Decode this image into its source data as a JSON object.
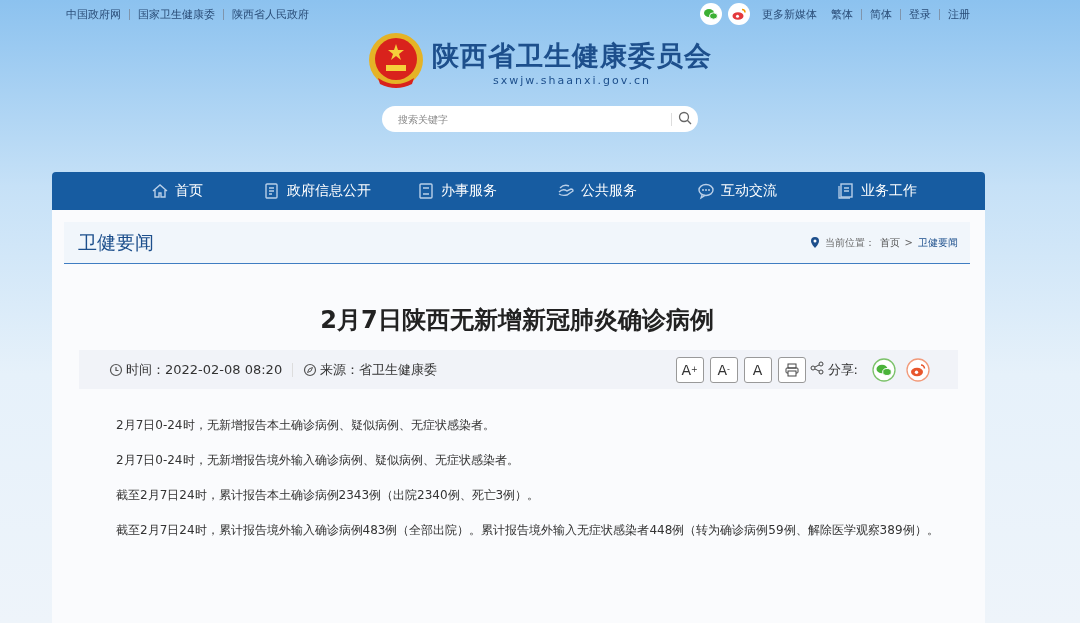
{
  "top_bar": {
    "links": [
      "中国政府网",
      "国家卫生健康委",
      "陕西省人民政府"
    ],
    "media_label": "更多新媒体",
    "account_links": [
      "繁体",
      "简体",
      "登录",
      "注册"
    ]
  },
  "header": {
    "title": "陕西省卫生健康委员会",
    "domain": "sxwjw.shaanxi.gov.cn",
    "search": {
      "placeholder": "搜索关键字"
    }
  },
  "nav": {
    "items": [
      {
        "label": "首页"
      },
      {
        "label": "政府信息公开"
      },
      {
        "label": "办事服务"
      },
      {
        "label": "公共服务"
      },
      {
        "label": "互动交流"
      },
      {
        "label": "业务工作"
      }
    ]
  },
  "section": {
    "title": "卫健要闻",
    "breadcrumb": {
      "label": "当前位置：",
      "items": [
        "首页",
        "卫健要闻"
      ],
      "separator": ">"
    }
  },
  "article": {
    "title": "2月7日陕西无新增新冠肺炎确诊病例",
    "time": "时间：2022-02-08 08:20",
    "source": "来源：省卫生健康委",
    "font_buttons": [
      "A$^{+}$",
      "A$^{-}$",
      "A"
    ],
    "share_label": "分享:",
    "paragraphs": [
      "2月7日0-24时，无新增报告本土确诊病例、疑似病例、无症状感染者。",
      "2月7日0-24时，无新增报告境外输入确诊病例、疑似病例、无症状感染者。",
      "截至2月7日24时，累计报告本土确诊病例2343例（出院2340例、死亡3例）。",
      "截至2月7日24时，累计报告境外输入确诊病例483例（全部出院）。累计报告境外输入无症状感染者448例（转为确诊病例59例、解除医学观察389例）。"
    ]
  }
}
